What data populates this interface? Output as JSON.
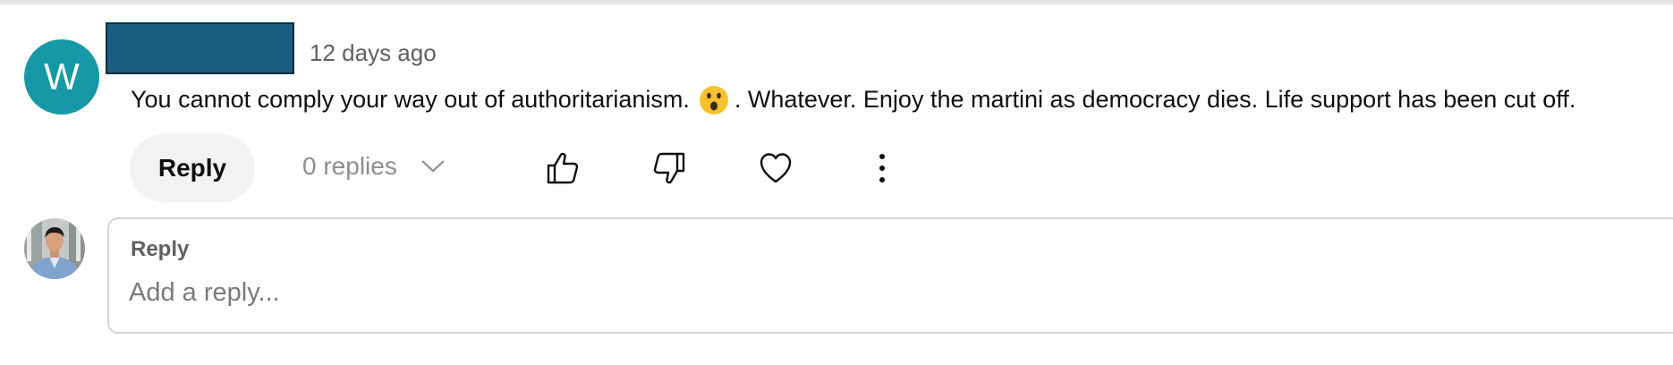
{
  "comment": {
    "avatar_letter": "W",
    "avatar_color": "#1698a6",
    "timestamp": "12 days ago",
    "text_part1": "You cannot comply your way out of authoritarianism.",
    "emoji": "astonished-face",
    "text_part2": ". Whatever.  Enjoy the martini as democracy dies.  Life support has been cut off.",
    "reply_label": "Reply",
    "replies_count_label": "0 replies"
  },
  "reply_box": {
    "label": "Reply",
    "placeholder": "Add a reply..."
  },
  "icons": {
    "like": "thumb-up-icon",
    "dislike": "thumb-down-icon",
    "heart": "heart-icon",
    "more": "more-vertical-icon",
    "expand": "chevron-down-icon"
  },
  "colors": {
    "redaction": "#1a5f82",
    "reply_button_bg": "#f2f2f2"
  }
}
